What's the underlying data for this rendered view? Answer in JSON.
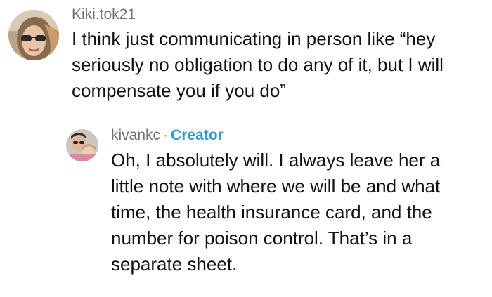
{
  "comments": [
    {
      "username": "Kiki.tok21",
      "avatar_icon": "user-avatar-sunglasses",
      "text": "I think just communicating in person like “hey seriously no obligation to do any of it, but I will compensate you if you do”"
    },
    {
      "username": "kivankc",
      "separator": "·",
      "badge": "Creator",
      "avatar_icon": "creator-avatar-group-photo",
      "text": "Oh, I absolutely will. I always leave her a little note with where we will be and what time, the health insurance card, and the number for poison control. That’s in a separate sheet."
    }
  ],
  "colors": {
    "username": "#6f7076",
    "creator_badge": "#2e9ad0",
    "text": "#111111"
  }
}
